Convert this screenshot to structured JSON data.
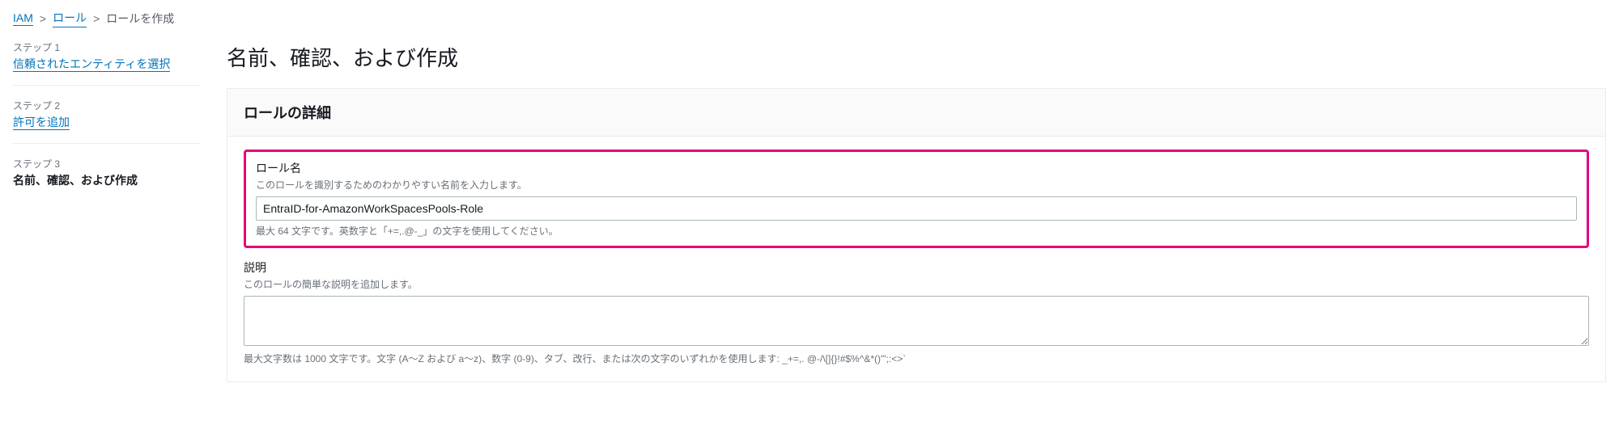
{
  "breadcrumb": {
    "items": [
      {
        "label": "IAM",
        "link": true
      },
      {
        "label": "ロール",
        "link": true
      },
      {
        "label": "ロールを作成",
        "link": false
      }
    ]
  },
  "sidebar": {
    "steps": [
      {
        "label": "ステップ 1",
        "title": "信頼されたエンティティを選択",
        "state": "link"
      },
      {
        "label": "ステップ 2",
        "title": "許可を追加",
        "state": "link"
      },
      {
        "label": "ステップ 3",
        "title": "名前、確認、および作成",
        "state": "active"
      }
    ]
  },
  "main": {
    "heading": "名前、確認、および作成",
    "panel_title": "ロールの詳細",
    "role_name": {
      "label": "ロール名",
      "hint": "このロールを識別するためのわかりやすい名前を入力します。",
      "value": "EntraID-for-AmazonWorkSpacesPools-Role",
      "constraint": "最大 64 文字です。英数字と「+=,.@-_」の文字を使用してください。"
    },
    "description": {
      "label": "説明",
      "hint": "このロールの簡単な説明を追加します。",
      "value": "",
      "constraint": "最大文字数は 1000 文字です。文字 (A～Z および a～z)、数字 (0-9)、タブ、改行、または次の文字のいずれかを使用します: _+=,. @-/\\[]{}!#$%^&*()\"';:<>`"
    }
  }
}
